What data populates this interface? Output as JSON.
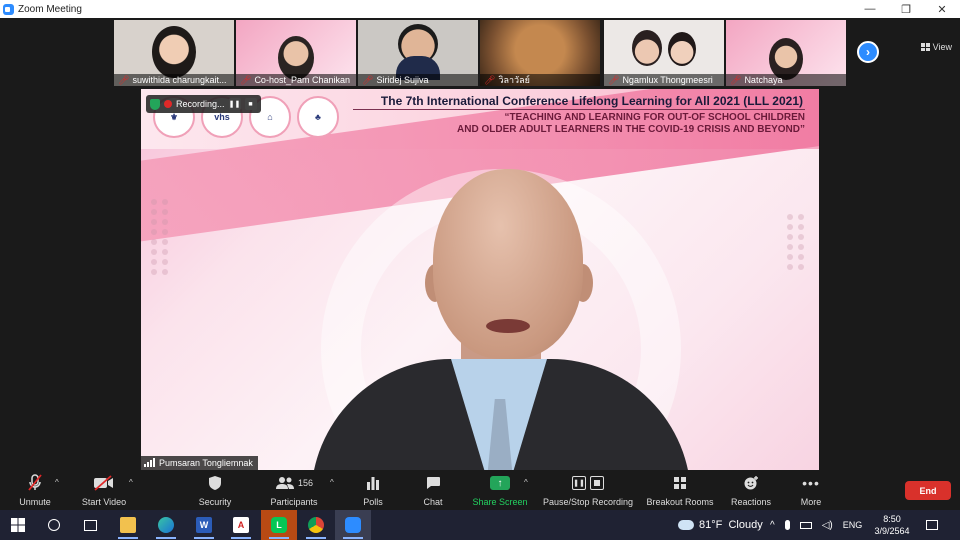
{
  "window": {
    "title": "Zoom Meeting",
    "buttons": {
      "minimize": "—",
      "restore": "❐",
      "close": "✕"
    }
  },
  "gallery": {
    "view_label": "View",
    "participants": [
      {
        "name": "suwithida charungkait...",
        "muted": true
      },
      {
        "name": "Co-host_Pam Chanikan",
        "muted": true
      },
      {
        "name": "Siridej Sujiva",
        "muted": true
      },
      {
        "name": "วิลาวัลย์",
        "muted": true
      },
      {
        "name": "Ngamlux Thongmeesri",
        "muted": true
      },
      {
        "name": "Natchaya",
        "muted": true
      }
    ],
    "next_icon": "chevron-right-icon"
  },
  "main_video": {
    "recording_label": "Recording...",
    "conference_title": "The 7th International Conference Lifelong Learning for All 2021 (LLL 2021)",
    "conference_subtitle_1": "“TEACHING AND LEARNING FOR OUT-OF SCHOOL CHILDREN",
    "conference_subtitle_2": "AND OLDER ADULT LEARNERS IN THE COVID-19 CRISIS AND BEYOND”",
    "logo_2_text": "vhs",
    "speaker_name": "Pumsaran Tongliemnak"
  },
  "toolbar": {
    "unmute": "Unmute",
    "start_video": "Start Video",
    "security": "Security",
    "participants": "Participants",
    "participant_count": "156",
    "polls": "Polls",
    "chat": "Chat",
    "share_screen": "Share Screen",
    "pause_stop_recording": "Pause/Stop Recording",
    "breakout_rooms": "Breakout Rooms",
    "reactions": "Reactions",
    "more": "More",
    "end": "End",
    "colors": {
      "share": "#23d160",
      "end": "#d9312b",
      "accent": "#2d8cff"
    }
  },
  "taskbar": {
    "weather": "81°F  Cloudy",
    "language": "ENG",
    "time": "8:50",
    "date": "3/9/2564",
    "apps": [
      "start-icon",
      "search-icon",
      "task-view-icon",
      "file-explorer-icon",
      "edge-icon",
      "word-icon",
      "acrobat-icon",
      "line-icon",
      "chrome-icon",
      "zoom-icon"
    ]
  }
}
